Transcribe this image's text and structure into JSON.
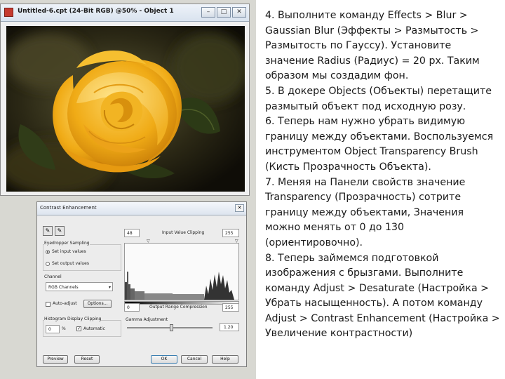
{
  "image_window": {
    "title": "Untitled-6.cpt (24-Bit RGB) @50% - Object 1",
    "buttons": {
      "minimize": "–",
      "maximize": "□",
      "close": "✕"
    }
  },
  "dialog": {
    "title": "Contrast Enhancement",
    "close_glyph": "✕",
    "eyedropper_group_label": "Eyedropper Sampling",
    "set_input": "Set input values",
    "set_output": "Set output values",
    "channel_label": "Channel",
    "channel_value": "RGB Channels",
    "auto_adjust": "Auto-adjust",
    "options_button": "Options...",
    "histogram_group_label": "Histogram Display Clipping",
    "clip_value": "0",
    "clip_unit": "%",
    "automatic": "Automatic",
    "input_low": "48",
    "input_high": "255",
    "input_label": "Input Value Clipping",
    "output_low": "0",
    "output_high": "255",
    "output_label": "Output Range Compression",
    "gamma_label": "Gamma Adjustment",
    "gamma_value": "1.20",
    "gamma_level": 0.52,
    "preview_btn": "Preview",
    "reset_btn": "Reset",
    "ok_btn": "OK",
    "cancel_btn": "Cancel",
    "help_btn": "Help"
  },
  "instructions": [
    "4. Выполните команду Effects > Blur > Gaussian Blur (Эффекты > Размытость > Размытость по Гауссу). Установите значение Radius (Радиус) = 20 px. Таким образом мы создадим фон.",
    "5. В докере Objects (Объекты) перетащите размытый объект под исходную розу.",
    "6. Теперь нам нужно убрать видимую границу между объектами. Воспользуемся инструментом Object Transparency Brush (Кисть Прозрачность Объекта).",
    "7. Меняя на Панели свойств значение Transparency (Прозрачность) сотрите границу между объектами, Значения можно менять от 0 до 130 (ориентировочно).",
    "8. Теперь займемся подготовкой изображения с брызгами. Выполните команду Adjust > Desaturate (Настройка > Убрать насыщенность). А потом команду Adjust > Contrast Enhancement (Настройка > Увеличение контрастности)"
  ],
  "colors": {
    "rose": "#f2b21d",
    "leaf": "#2e3a18",
    "accent": "#3c7fb1"
  }
}
